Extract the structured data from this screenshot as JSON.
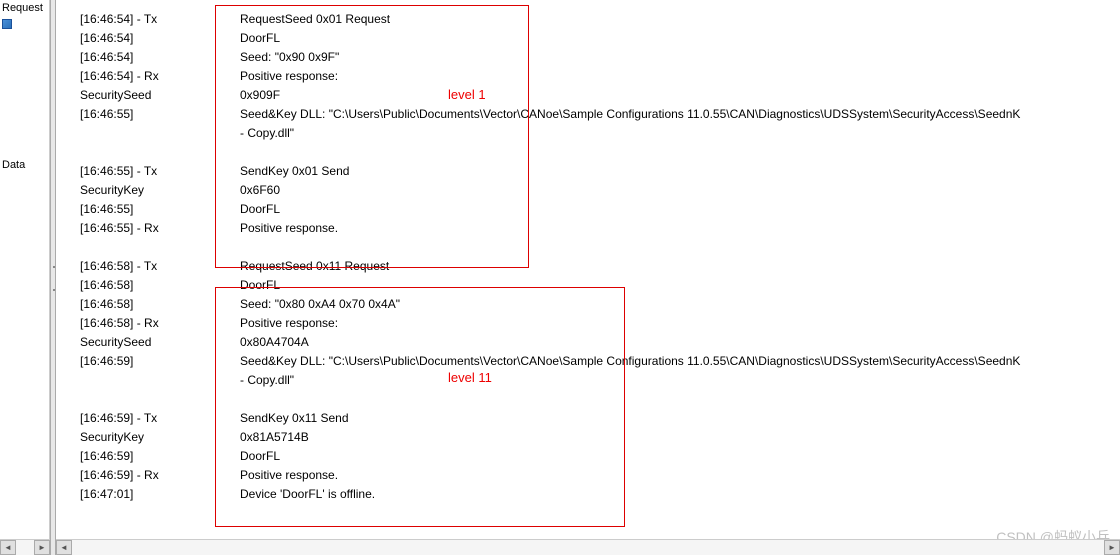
{
  "sidebar": {
    "items": [
      {
        "label": "Request"
      },
      {
        "label": ""
      },
      {
        "label": "Data"
      }
    ]
  },
  "labels": {
    "level1": "level 1",
    "level11": "level 11"
  },
  "log": {
    "lines": [
      {
        "ts": "[16:46:54] - Tx",
        "msg": "RequestSeed 0x01 Request"
      },
      {
        "ts": "[16:46:54]",
        "msg": "DoorFL"
      },
      {
        "ts": "[16:46:54]",
        "msg": "Seed: \"0x90 0x9F\""
      },
      {
        "ts": "[16:46:54] - Rx",
        "msg": "Positive response:"
      },
      {
        "ts": "   SecuritySeed",
        "msg": "   0x909F"
      },
      {
        "ts": "[16:46:55]",
        "msg": "Seed&Key DLL: \"C:\\Users\\Public\\Documents\\Vector\\CANoe\\Sample Configurations 11.0.55\\CAN\\Diagnostics\\UDSSystem\\SecurityAccess\\SeednK"
      },
      {
        "ts": "",
        "msg": " - Copy.dll\""
      },
      {
        "ts": "",
        "msg": ""
      },
      {
        "ts": "[16:46:55] - Tx",
        "msg": "SendKey 0x01 Send"
      },
      {
        "ts": "   SecurityKey",
        "msg": "   0x6F60"
      },
      {
        "ts": "[16:46:55]",
        "msg": "DoorFL"
      },
      {
        "ts": "[16:46:55] - Rx",
        "msg": "Positive response."
      },
      {
        "ts": "",
        "msg": ""
      },
      {
        "ts": "[16:46:58] - Tx",
        "msg": "RequestSeed 0x11 Request"
      },
      {
        "ts": "[16:46:58]",
        "msg": "DoorFL"
      },
      {
        "ts": "[16:46:58]",
        "msg": "Seed: \"0x80 0xA4 0x70 0x4A\""
      },
      {
        "ts": "[16:46:58] - Rx",
        "msg": "Positive response:"
      },
      {
        "ts": "   SecuritySeed",
        "msg": "   0x80A4704A"
      },
      {
        "ts": "[16:46:59]",
        "msg": "Seed&Key DLL: \"C:\\Users\\Public\\Documents\\Vector\\CANoe\\Sample Configurations 11.0.55\\CAN\\Diagnostics\\UDSSystem\\SecurityAccess\\SeednK"
      },
      {
        "ts": "",
        "msg": " - Copy.dll\""
      },
      {
        "ts": "",
        "msg": ""
      },
      {
        "ts": "[16:46:59] - Tx",
        "msg": "SendKey 0x11 Send"
      },
      {
        "ts": "   SecurityKey",
        "msg": "   0x81A5714B"
      },
      {
        "ts": "[16:46:59]",
        "msg": "DoorFL"
      },
      {
        "ts": "[16:46:59] - Rx",
        "msg": "Positive response."
      },
      {
        "ts": "[16:47:01]",
        "msg": "Device 'DoorFL' is offline."
      }
    ]
  },
  "watermark": "CSDN @蚂蚁小兵"
}
